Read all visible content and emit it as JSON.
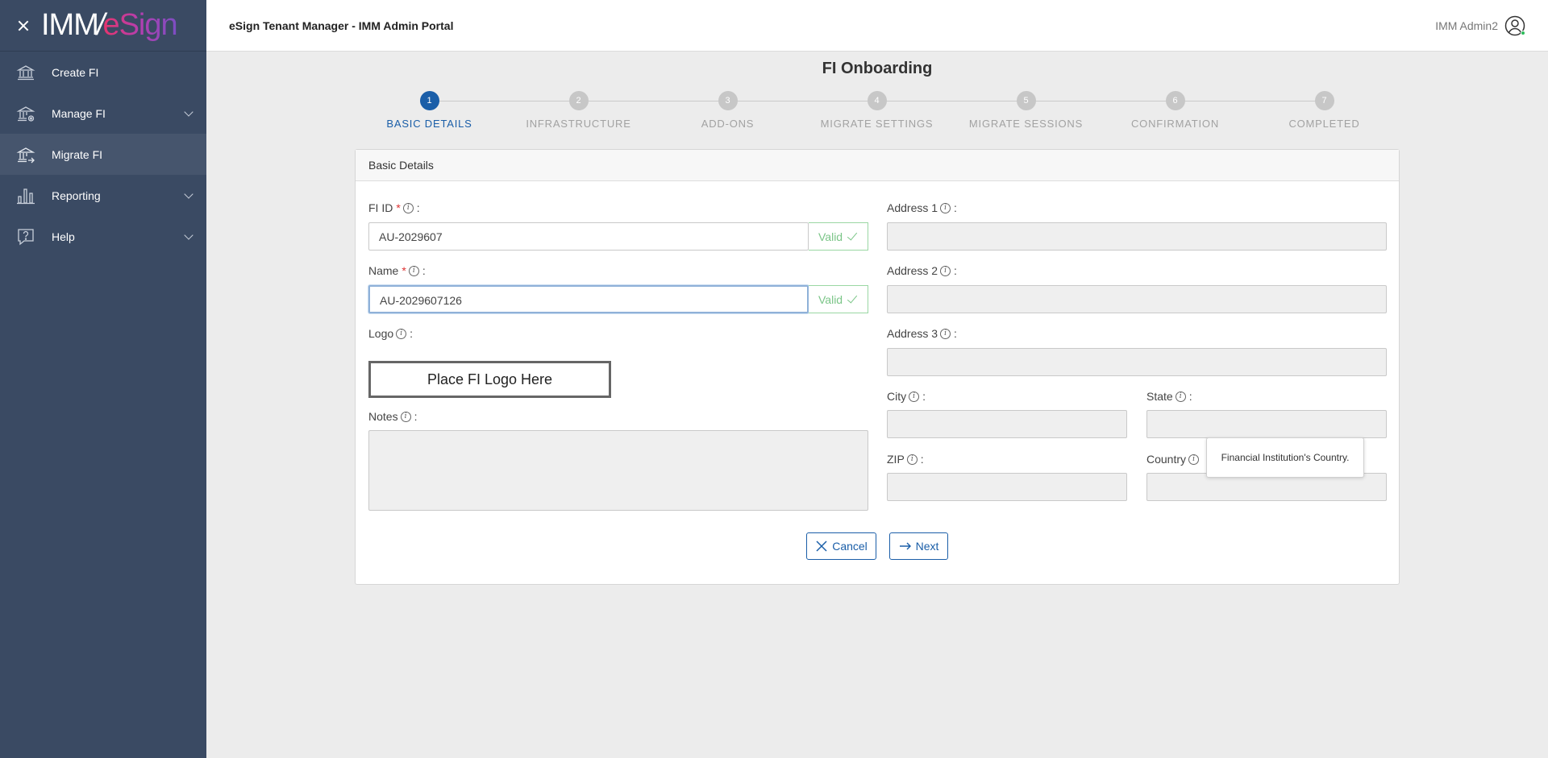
{
  "brand": {
    "imm": "IMM",
    "slash": "/",
    "esign": "eSign"
  },
  "sidebar": {
    "items": [
      {
        "label": "Create FI",
        "icon": "bank-icon"
      },
      {
        "label": "Manage FI",
        "icon": "bank-gear-icon"
      },
      {
        "label": "Migrate FI",
        "icon": "bank-arrow-icon"
      },
      {
        "label": "Reporting",
        "icon": "bar-chart-icon"
      },
      {
        "label": "Help",
        "icon": "help-icon"
      }
    ]
  },
  "header": {
    "title": "eSign Tenant Manager - IMM Admin Portal",
    "user": "IMM Admin2"
  },
  "page": {
    "title": "FI Onboarding"
  },
  "steps": [
    {
      "num": "1",
      "label": "BASIC DETAILS"
    },
    {
      "num": "2",
      "label": "INFRASTRUCTURE"
    },
    {
      "num": "3",
      "label": "ADD-ONS"
    },
    {
      "num": "4",
      "label": "MIGRATE SETTINGS"
    },
    {
      "num": "5",
      "label": "MIGRATE SESSIONS"
    },
    {
      "num": "6",
      "label": "CONFIRMATION"
    },
    {
      "num": "7",
      "label": "COMPLETED"
    }
  ],
  "form": {
    "section_title": "Basic Details",
    "fi_id": {
      "label": "FI ID",
      "value": "AU-2029607",
      "status": "Valid"
    },
    "name": {
      "label": "Name",
      "value": "AU-2029607126",
      "status": "Valid"
    },
    "logo": {
      "label": "Logo",
      "placeholder": "Place FI Logo Here"
    },
    "notes": {
      "label": "Notes",
      "value": ""
    },
    "address1": {
      "label": "Address 1",
      "value": ""
    },
    "address2": {
      "label": "Address 2",
      "value": ""
    },
    "address3": {
      "label": "Address 3",
      "value": ""
    },
    "city": {
      "label": "City",
      "value": ""
    },
    "state": {
      "label": "State",
      "value": ""
    },
    "zip": {
      "label": "ZIP",
      "value": ""
    },
    "country": {
      "label": "Country",
      "value": ""
    },
    "required_mark": "*",
    "info_glyph": "i",
    "colon": ":"
  },
  "tooltip": {
    "text": "Financial Institution's Country."
  },
  "buttons": {
    "cancel": "Cancel",
    "next": "Next"
  },
  "colors": {
    "sidebar": "#3a4a63",
    "active_step": "#1a5ea8",
    "valid": "#7ac587"
  }
}
